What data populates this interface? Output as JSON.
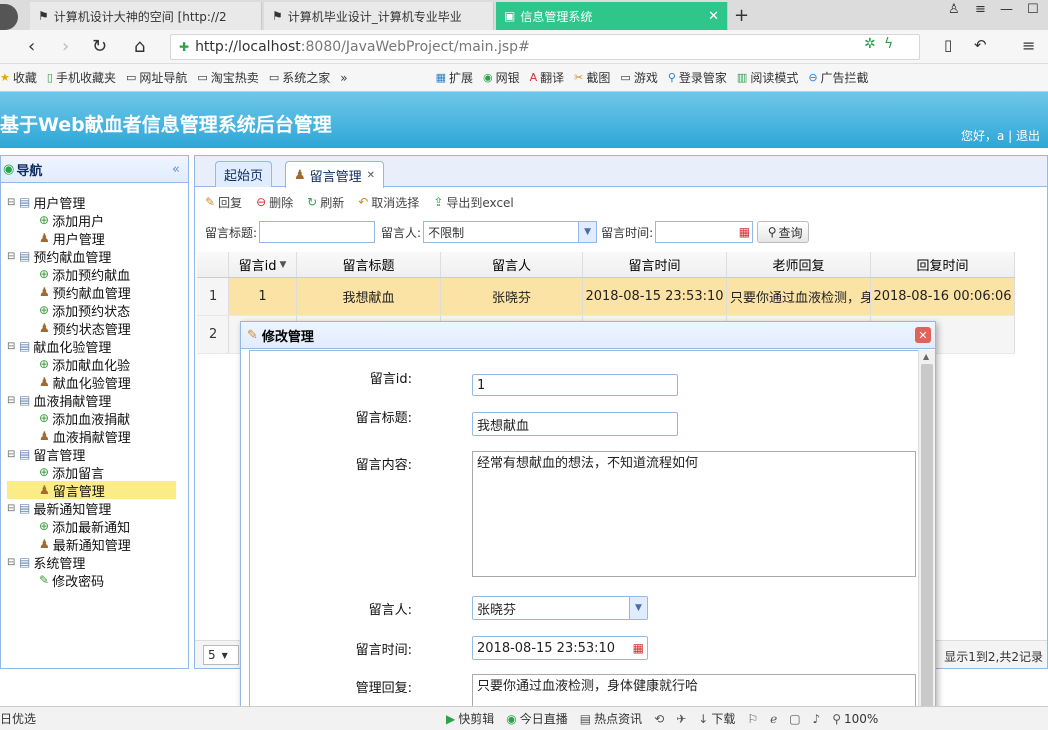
{
  "browser": {
    "tabs": [
      {
        "label": "计算机设计大神的空间 [http://2"
      },
      {
        "label": "计算机毕业设计_计算机专业毕业"
      },
      {
        "label": "信息管理系统"
      }
    ],
    "url_host": "http://localhost",
    "url_rest": ":8080/JavaWebProject/main.jsp#",
    "bookmarks": [
      "收藏",
      "手机收藏夹",
      "网址导航",
      "淘宝热卖",
      "系统之家",
      "»",
      "扩展",
      "网银",
      "翻译",
      "截图",
      "游戏",
      "登录管家",
      "阅读模式",
      "广告拦截"
    ]
  },
  "app": {
    "title": "基于Web献血者信息管理系统后台管理",
    "user_line": "您好，a | 退出"
  },
  "nav": {
    "title": "导航",
    "collapse_symbol": "«",
    "groups": [
      {
        "label": "用户管理",
        "items": [
          "添加用户",
          "用户管理"
        ]
      },
      {
        "label": "预约献血管理",
        "items": [
          "添加预约献血",
          "预约献血管理",
          "添加预约状态",
          "预约状态管理"
        ]
      },
      {
        "label": "献血化验管理",
        "items": [
          "添加献血化验",
          "献血化验管理"
        ]
      },
      {
        "label": "血液捐献管理",
        "items": [
          "添加血液捐献",
          "血液捐献管理"
        ]
      },
      {
        "label": "留言管理",
        "items": [
          "添加留言",
          "留言管理"
        ]
      },
      {
        "label": "最新通知管理",
        "items": [
          "添加最新通知",
          "最新通知管理"
        ]
      },
      {
        "label": "系统管理",
        "items": [
          "修改密码"
        ]
      }
    ]
  },
  "content": {
    "tabs": [
      "起始页",
      "留言管理"
    ],
    "toolbar": {
      "reply": "回复",
      "delete": "删除",
      "refresh": "刷新",
      "cancel_select": "取消选择",
      "export": "导出到excel"
    },
    "search": {
      "title_label": "留言标题:",
      "person_label": "留言人:",
      "person_value": "不限制",
      "time_label": "留言时间:",
      "query_button": "查询"
    },
    "grid": {
      "columns": [
        "留言id",
        "留言标题",
        "留言人",
        "留言时间",
        "老师回复",
        "回复时间"
      ],
      "rows": [
        {
          "rownum": "1",
          "id": "1",
          "title": "我想献血",
          "person": "张晓芬",
          "time": "2018-08-15 23:53:10",
          "reply": "只要你通过血液检测，身",
          "reply_time": "2018-08-16 00:06:06"
        },
        {
          "rownum": "2",
          "id": "",
          "title": "",
          "person": "",
          "time": "",
          "reply": "",
          "reply_time": "-"
        }
      ]
    },
    "pager": {
      "page_size": "5",
      "summary": "显示1到2,共2记录"
    }
  },
  "dialog": {
    "title": "修改管理",
    "fields": {
      "id_label": "留言id:",
      "id_value": "1",
      "title_label": "留言标题:",
      "title_value": "我想献血",
      "content_label": "留言内容:",
      "content_value": "经常有想献血的想法，不知道流程如何",
      "person_label": "留言人:",
      "person_value": "张晓芬",
      "time_label": "留言时间:",
      "time_value": "2018-08-15 23:53:10",
      "reply_label": "管理回复:",
      "reply_value": "只要你通过血液检测，身体健康就行哈"
    }
  },
  "statusbar": {
    "left": "日优选",
    "items": [
      "快剪辑",
      "今日直播",
      "热点资讯",
      "下载"
    ],
    "zoom": "100%"
  }
}
